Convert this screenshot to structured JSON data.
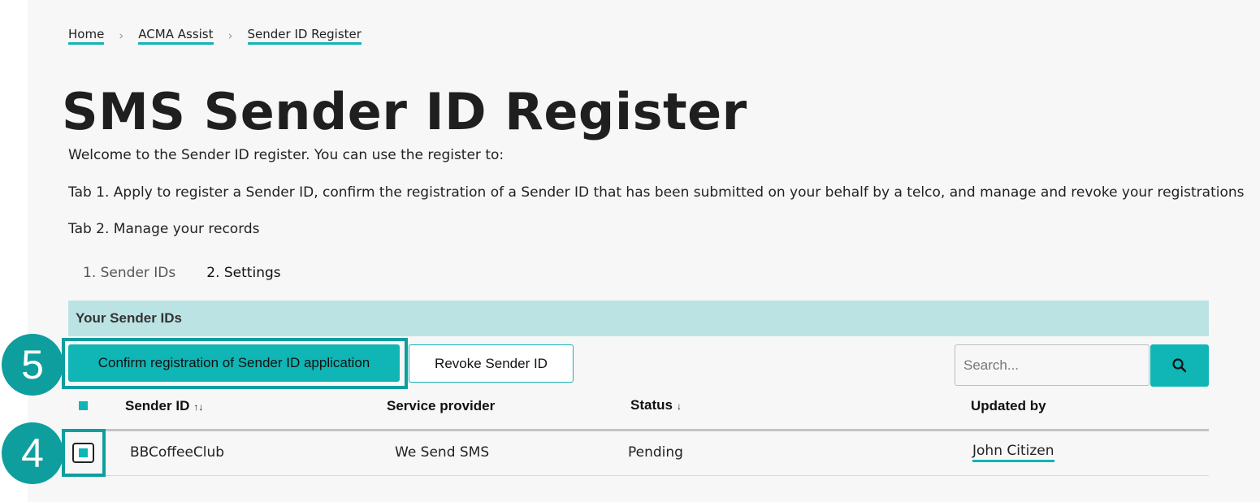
{
  "breadcrumb": [
    {
      "label": "Home"
    },
    {
      "label": "ACMA Assist"
    },
    {
      "label": "Sender ID Register"
    }
  ],
  "page_title": "SMS Sender ID Register",
  "intro": {
    "line1": "Welcome to the Sender ID register. You can use the register to:",
    "line2": "Tab 1. Apply to register a Sender ID, confirm the registration of a Sender ID that has been submitted on your behalf by a telco, and manage and revoke your registrations",
    "line3": "Tab 2. Manage your records"
  },
  "tabs": [
    {
      "label": "1. Sender IDs",
      "active": false
    },
    {
      "label": "2. Settings",
      "active": true
    }
  ],
  "section_title": "Your Sender IDs",
  "actions": {
    "confirm_label": "Confirm registration of Sender ID application",
    "revoke_label": "Revoke Sender ID"
  },
  "search": {
    "placeholder": "Search...",
    "value": "",
    "button_icon": "search-icon"
  },
  "table": {
    "columns": [
      {
        "label": "Sender ID",
        "sort_icon": "↑↓"
      },
      {
        "label": "Service provider",
        "sort_icon": ""
      },
      {
        "label": "Status",
        "sort_icon": "↓"
      },
      {
        "label": "Updated by",
        "sort_icon": ""
      }
    ],
    "rows": [
      {
        "sender_id": "BBCoffeeClub",
        "service_provider": "We Send SMS",
        "status": "Pending",
        "updated_by": "John Citizen",
        "selected": true
      }
    ]
  },
  "annotations": {
    "step4": "4",
    "step5": "5"
  },
  "colors": {
    "accent": "#10b5b5",
    "annotation": "#0e9e9e",
    "section_bar": "#bce3e3",
    "page_bg": "#f7f7f7"
  }
}
